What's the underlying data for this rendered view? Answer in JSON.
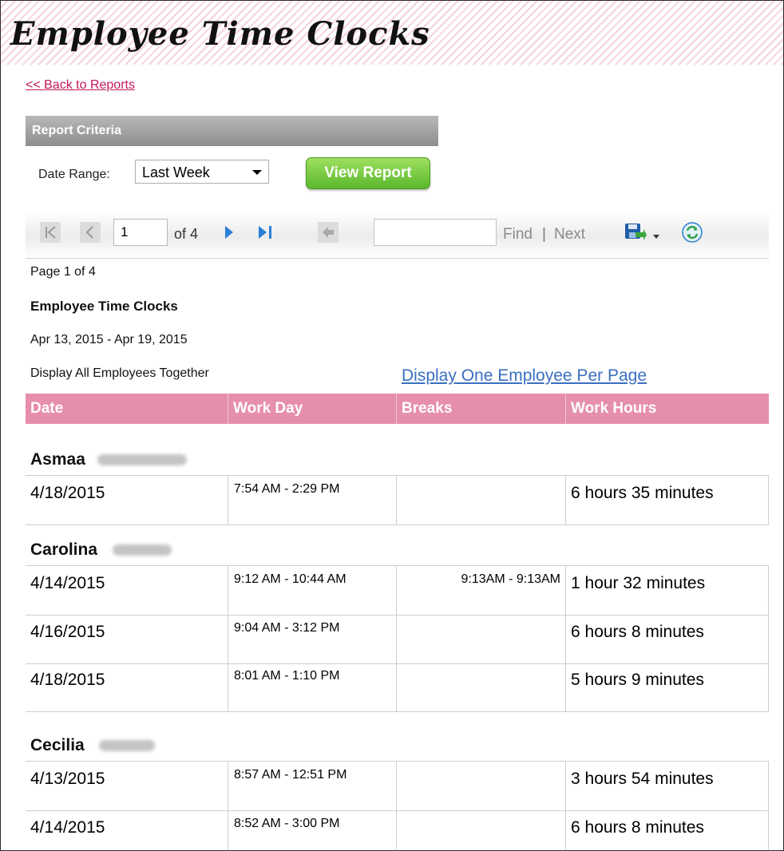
{
  "page": {
    "title": "Employee Time Clocks",
    "back_link": "<< Back to Reports"
  },
  "criteria": {
    "header": "Report Criteria",
    "date_range_label": "Date Range:",
    "date_range_value": "Last Week",
    "view_button": "View Report"
  },
  "toolbar": {
    "page_number": "1",
    "of_total": "of 4",
    "find_placeholder": "",
    "find_label": "Find",
    "separator": "|",
    "next_label": "Next"
  },
  "report": {
    "page_info": "Page 1 of 4",
    "title": "Employee Time Clocks",
    "date_span": "Apr 13, 2015 - Apr 19, 2015",
    "display_mode": "Display All Employees Together",
    "per_page_link": "Display One Employee Per Page",
    "columns": [
      "Date",
      "Work Day",
      "Breaks",
      "Work Hours"
    ]
  },
  "employees": [
    {
      "first_name": "Asmaa",
      "rows": [
        {
          "date": "4/18/2015",
          "work_day": "7:54 AM - 2:29 PM",
          "breaks": "",
          "hours": "6 hours 35 minutes"
        }
      ]
    },
    {
      "first_name": "Carolina",
      "rows": [
        {
          "date": "4/14/2015",
          "work_day": "9:12 AM - 10:44 AM",
          "breaks": "9:13AM - 9:13AM",
          "hours": "1 hour 32 minutes"
        },
        {
          "date": "4/16/2015",
          "work_day": "9:04 AM - 3:12 PM",
          "breaks": "",
          "hours": "6 hours 8 minutes"
        },
        {
          "date": "4/18/2015",
          "work_day": "8:01 AM - 1:10 PM",
          "breaks": "",
          "hours": "5 hours 9 minutes"
        }
      ]
    },
    {
      "first_name": "Cecilia",
      "rows": [
        {
          "date": "4/13/2015",
          "work_day": "8:57 AM - 12:51 PM",
          "breaks": "",
          "hours": "3 hours 54 minutes"
        },
        {
          "date": "4/14/2015",
          "work_day": "8:52 AM - 3:00 PM",
          "breaks": "",
          "hours": "6 hours 8 minutes"
        }
      ]
    }
  ],
  "colors": {
    "header_pink": "#e68eae",
    "link_red": "#c2185b",
    "link_blue": "#3a6fc0",
    "button_green": "#5ab82c"
  },
  "icons": [
    "first-page-icon",
    "previous-page-icon",
    "next-page-icon",
    "last-page-icon",
    "back-to-parent-icon",
    "export-save-icon",
    "export-dropdown-icon",
    "refresh-icon"
  ]
}
